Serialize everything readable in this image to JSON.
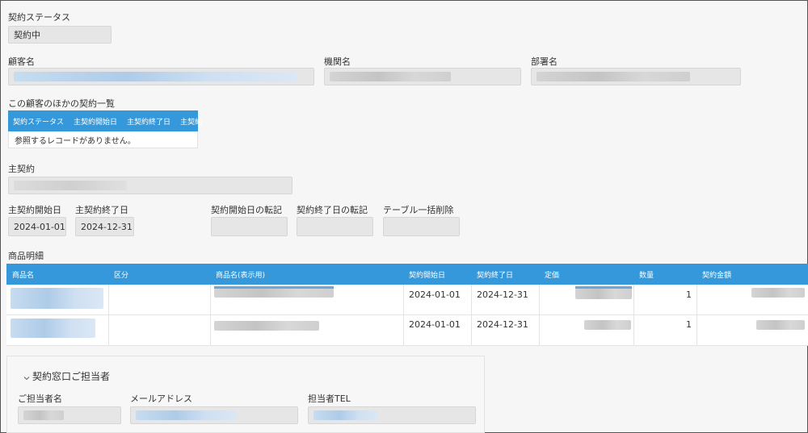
{
  "status": {
    "label": "契約ステータス",
    "value": "契約中"
  },
  "customer": {
    "label": "顧客名"
  },
  "org": {
    "label": "機関名"
  },
  "dept": {
    "label": "部署名"
  },
  "other_contracts": {
    "label": "この顧客のほかの契約一覧",
    "columns": [
      "契約ステータス",
      "主契約開始日",
      "主契約終了日",
      "主契約"
    ],
    "empty": "参照するレコードがありません。"
  },
  "main_contract": {
    "label": "主契約"
  },
  "dates": {
    "start_label": "主契約開始日",
    "start_value": "2024-01-01",
    "end_label": "主契約終了日",
    "end_value": "2024-12-31",
    "start_copy_label": "契約開始日の転記",
    "end_copy_label": "契約終了日の転記",
    "bulk_delete_label": "テーブル一括削除"
  },
  "items": {
    "label": "商品明細",
    "columns": [
      "商品名",
      "区分",
      "商品名(表示用)",
      "契約開始日",
      "契約終了日",
      "定価",
      "数量",
      "契約金額"
    ],
    "rows": [
      {
        "start": "2024-01-01",
        "end": "2024-12-31",
        "qty": "1"
      },
      {
        "start": "2024-01-01",
        "end": "2024-12-31",
        "qty": "1"
      }
    ]
  },
  "contact": {
    "section_title": "契約窓口ご担当者",
    "name_label": "ご担当者名",
    "email_label": "メールアドレス",
    "tel_label": "担当者TEL"
  },
  "icons": {
    "collapse": "chevron-down-icon"
  }
}
